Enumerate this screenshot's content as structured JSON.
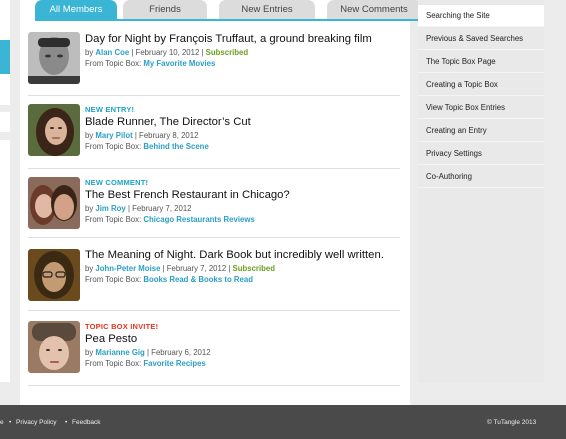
{
  "tabs": [
    {
      "label": "All Members",
      "active": true
    },
    {
      "label": "Friends",
      "active": false
    },
    {
      "label": "New Entries",
      "active": false
    },
    {
      "label": "New Comments",
      "active": false
    }
  ],
  "entries": [
    {
      "badge": "",
      "title": "Day for Night by François Truffaut, a ground breaking film",
      "by_prefix": "by",
      "author": "Alan Coe",
      "date": "| February 10, 2012 |",
      "subscribed": "Subscribed",
      "topic_prefix": "From Topic Box:",
      "topic": "My Favorite Movies"
    },
    {
      "badge": "NEW ENTRY!",
      "title": "Blade Runner, The Director’s Cut",
      "by_prefix": "by",
      "author": "Mary Pilot",
      "date": "| February 8, 2012",
      "subscribed": "",
      "topic_prefix": "From Topic Box:",
      "topic": "Behind the Scene"
    },
    {
      "badge": "NEW COMMENT!",
      "title": "The Best French Restaurant in Chicago?",
      "by_prefix": "by",
      "author": "Jim Roy",
      "date": "| February 7, 2012",
      "subscribed": "",
      "topic_prefix": "From Topic Box:",
      "topic": "Chicago Restaurants Reviews"
    },
    {
      "badge": "",
      "title": "The Meaning of Night. Dark Book but incredibly well written.",
      "by_prefix": "by",
      "author": "John-Peter Moise",
      "date": "| February 7, 2012 |",
      "subscribed": "Subscribed",
      "topic_prefix": "From Topic Box:",
      "topic": "Books Read & Books to Read"
    },
    {
      "badge": "TOPIC BOX INVITE!",
      "title": "Pea Pesto",
      "by_prefix": "by",
      "author": "Marianne Gig",
      "date": "| February 6, 2012",
      "subscribed": "",
      "topic_prefix": "From Topic Box:",
      "topic": "Favorite Recipes"
    }
  ],
  "sidebar": {
    "items": [
      "Searching the Site",
      "Previous & Saved Searches",
      "The Topic Box Page",
      "Creating a Topic Box",
      "View Topic Box Entries",
      "Creating an Entry",
      "Privacy Settings",
      "Co-Authoring"
    ]
  },
  "footer": {
    "cut_left": "e",
    "privacy": "Privacy Policy",
    "feedback": "Feedback",
    "copyright": "© TuTangle 2013"
  },
  "colors": {
    "accent": "#3bb5d6",
    "link": "#2b9fc4",
    "subscribed": "#6a9e1e",
    "invite": "#e0361f",
    "footer_bg": "#4a4a4a"
  }
}
